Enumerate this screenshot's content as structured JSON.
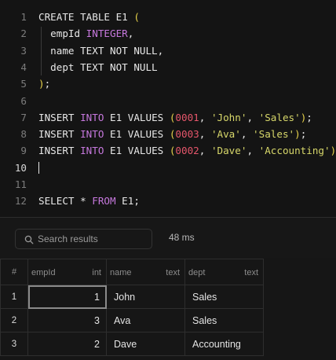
{
  "editor": {
    "lines": [
      {
        "n": "1",
        "tokens": [
          {
            "t": "CREATE TABLE E1 ",
            "c": ""
          },
          {
            "t": "(",
            "c": "paren"
          }
        ]
      },
      {
        "n": "2",
        "tokens": [
          {
            "t": "  empId ",
            "c": ""
          },
          {
            "t": "INTEGER",
            "c": "kw"
          },
          {
            "t": ",",
            "c": ""
          }
        ]
      },
      {
        "n": "3",
        "tokens": [
          {
            "t": "  name TEXT NOT NULL,",
            "c": ""
          }
        ]
      },
      {
        "n": "4",
        "tokens": [
          {
            "t": "  dept TEXT NOT NULL",
            "c": ""
          }
        ]
      },
      {
        "n": "5",
        "tokens": [
          {
            "t": ")",
            "c": "paren"
          },
          {
            "t": ";",
            "c": ""
          }
        ]
      },
      {
        "n": "6",
        "tokens": []
      },
      {
        "n": "7",
        "tokens": [
          {
            "t": "INSERT ",
            "c": ""
          },
          {
            "t": "INTO",
            "c": "kw"
          },
          {
            "t": " E1 VALUES ",
            "c": ""
          },
          {
            "t": "(",
            "c": "paren"
          },
          {
            "t": "0001",
            "c": "num"
          },
          {
            "t": ", ",
            "c": ""
          },
          {
            "t": "'John'",
            "c": "str"
          },
          {
            "t": ", ",
            "c": ""
          },
          {
            "t": "'Sales'",
            "c": "str"
          },
          {
            "t": ")",
            "c": "paren"
          },
          {
            "t": ";",
            "c": ""
          }
        ]
      },
      {
        "n": "8",
        "tokens": [
          {
            "t": "INSERT ",
            "c": ""
          },
          {
            "t": "INTO",
            "c": "kw"
          },
          {
            "t": " E1 VALUES ",
            "c": ""
          },
          {
            "t": "(",
            "c": "paren"
          },
          {
            "t": "0003",
            "c": "num"
          },
          {
            "t": ", ",
            "c": ""
          },
          {
            "t": "'Ava'",
            "c": "str"
          },
          {
            "t": ", ",
            "c": ""
          },
          {
            "t": "'Sales'",
            "c": "str"
          },
          {
            "t": ")",
            "c": "paren"
          },
          {
            "t": ";",
            "c": ""
          }
        ]
      },
      {
        "n": "9",
        "tokens": [
          {
            "t": "INSERT ",
            "c": ""
          },
          {
            "t": "INTO",
            "c": "kw"
          },
          {
            "t": " E1 VALUES ",
            "c": ""
          },
          {
            "t": "(",
            "c": "paren"
          },
          {
            "t": "0002",
            "c": "num"
          },
          {
            "t": ", ",
            "c": ""
          },
          {
            "t": "'Dave'",
            "c": "str"
          },
          {
            "t": ", ",
            "c": ""
          },
          {
            "t": "'Accounting'",
            "c": "str"
          },
          {
            "t": ")",
            "c": "paren"
          },
          {
            "t": ";",
            "c": ""
          }
        ]
      },
      {
        "n": "10",
        "tokens": [],
        "cursor": true
      },
      {
        "n": "11",
        "tokens": []
      },
      {
        "n": "12",
        "tokens": [
          {
            "t": "SELECT * ",
            "c": ""
          },
          {
            "t": "FROM",
            "c": "kw"
          },
          {
            "t": " E1;",
            "c": ""
          }
        ]
      }
    ]
  },
  "results": {
    "search_placeholder": "Search results",
    "search_icon": "search-icon",
    "timing": "48 ms",
    "columns": [
      {
        "name": "#",
        "type": ""
      },
      {
        "name": "empId",
        "type": "int"
      },
      {
        "name": "name",
        "type": "text"
      },
      {
        "name": "dept",
        "type": "text"
      }
    ],
    "rows": [
      {
        "idx": "1",
        "empId": "1",
        "name": "John",
        "dept": "Sales"
      },
      {
        "idx": "2",
        "empId": "3",
        "name": "Ava",
        "dept": "Sales"
      },
      {
        "idx": "3",
        "empId": "2",
        "name": "Dave",
        "dept": "Accounting"
      }
    ],
    "selected_cell": {
      "row": 0,
      "column": "empId"
    }
  },
  "colors": {
    "keyword": "#c678dd",
    "number": "#e5566b",
    "string": "#d7d76a",
    "paren": "#e8d34a"
  }
}
